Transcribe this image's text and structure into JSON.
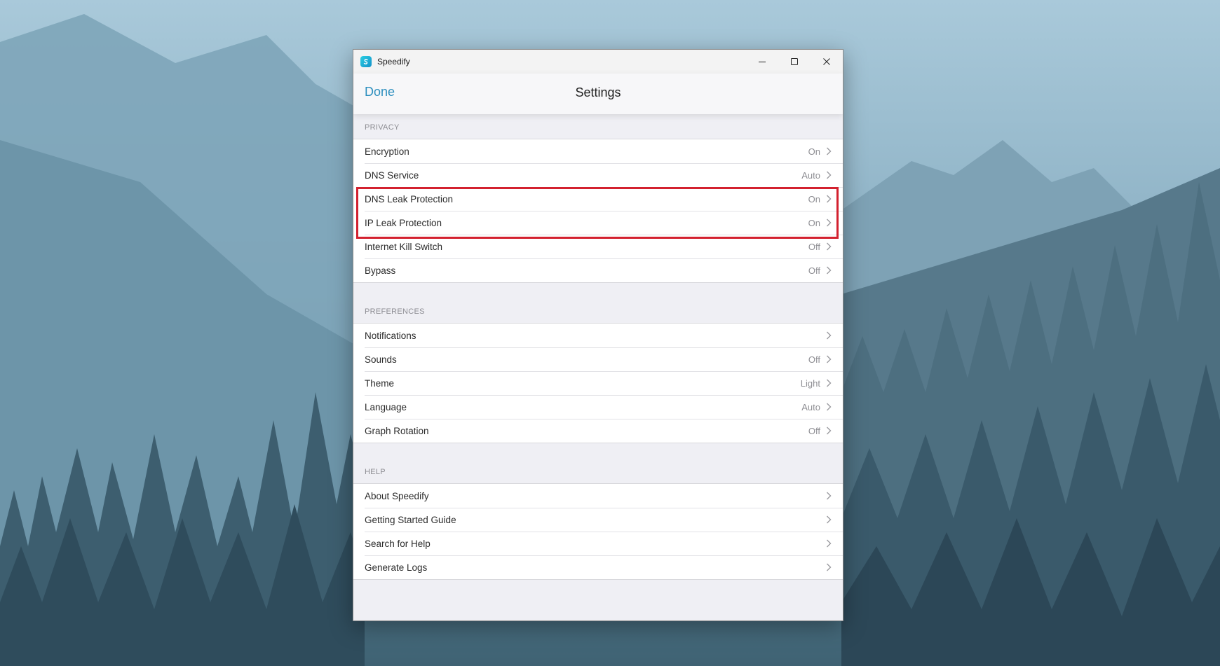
{
  "window": {
    "app_title": "Speedify",
    "controls": {
      "minimize_icon": "minimize-icon",
      "maximize_icon": "maximize-icon",
      "close_icon": "close-icon"
    }
  },
  "header": {
    "done_label": "Done",
    "title": "Settings"
  },
  "sections": {
    "privacy": {
      "title": "PRIVACY",
      "items": [
        {
          "label": "Encryption",
          "value": "On"
        },
        {
          "label": "DNS Service",
          "value": "Auto"
        },
        {
          "label": "DNS Leak Protection",
          "value": "On"
        },
        {
          "label": "IP Leak Protection",
          "value": "On"
        },
        {
          "label": "Internet Kill Switch",
          "value": "Off"
        },
        {
          "label": "Bypass",
          "value": "Off"
        }
      ]
    },
    "preferences": {
      "title": "PREFERENCES",
      "items": [
        {
          "label": "Notifications",
          "value": ""
        },
        {
          "label": "Sounds",
          "value": "Off"
        },
        {
          "label": "Theme",
          "value": "Light"
        },
        {
          "label": "Language",
          "value": "Auto"
        },
        {
          "label": "Graph Rotation",
          "value": "Off"
        }
      ]
    },
    "help": {
      "title": "HELP",
      "items": [
        {
          "label": "About Speedify",
          "value": ""
        },
        {
          "label": "Getting Started Guide",
          "value": ""
        },
        {
          "label": "Search for Help",
          "value": ""
        },
        {
          "label": "Generate Logs",
          "value": ""
        }
      ]
    }
  },
  "colors": {
    "accent": "#2d8fbe",
    "highlight": "#d3212f",
    "background": "#efeff4"
  }
}
